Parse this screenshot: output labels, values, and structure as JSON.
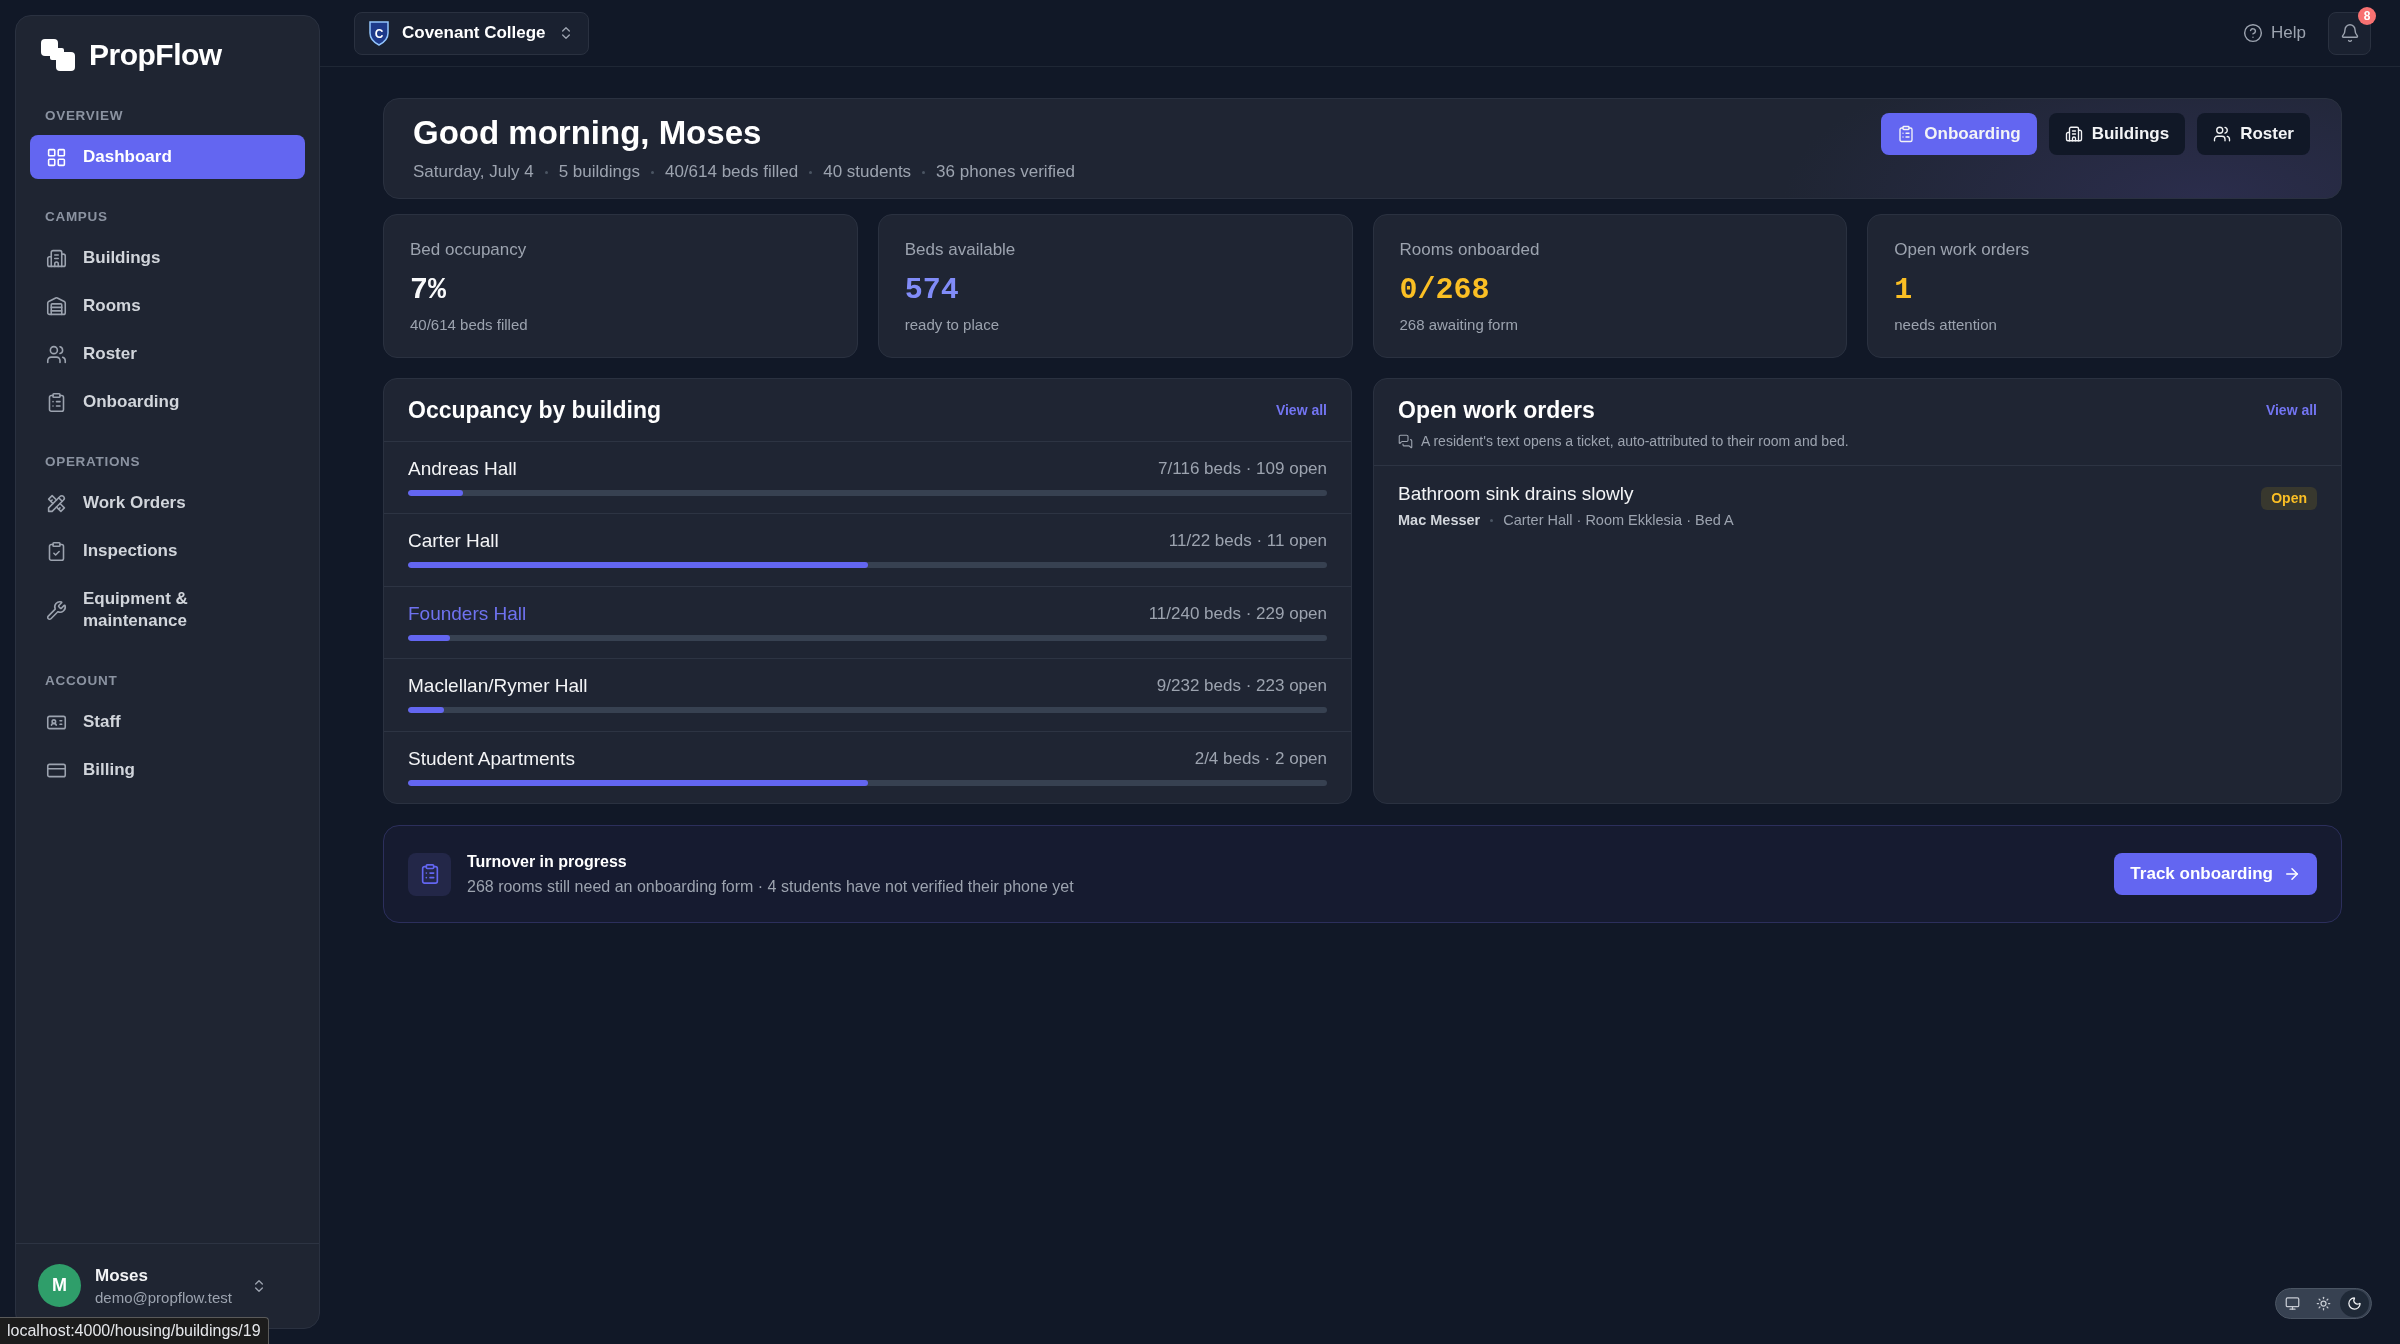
{
  "sidebar": {
    "brand": "PropFlow",
    "sections": [
      {
        "heading": "OVERVIEW",
        "items": [
          {
            "label": "Dashboard",
            "selected": true
          }
        ]
      },
      {
        "heading": "CAMPUS",
        "items": [
          {
            "label": "Buildings",
            "selected": false
          },
          {
            "label": "Rooms",
            "selected": false
          },
          {
            "label": "Roster",
            "selected": false
          },
          {
            "label": "Onboarding",
            "selected": false
          }
        ]
      },
      {
        "heading": "OPERATIONS",
        "items": [
          {
            "label": "Work Orders",
            "selected": false
          },
          {
            "label": "Inspections",
            "selected": false
          },
          {
            "label": "Equipment & maintenance",
            "selected": false
          }
        ]
      },
      {
        "heading": "ACCOUNT",
        "items": [
          {
            "label": "Staff",
            "selected": false
          },
          {
            "label": "Billing",
            "selected": false
          }
        ]
      }
    ],
    "user": {
      "initial": "M",
      "name": "Moses",
      "email": "demo@propflow.test"
    }
  },
  "top_bar": {
    "campus": {
      "crest_letter": "C",
      "name": "Covenant College"
    },
    "help": "Help",
    "notifications": {
      "count": "8"
    }
  },
  "header": {
    "greeting": "Good morning, Moses",
    "facts": [
      "Saturday, July 4",
      "5 buildings",
      "40/614 beds filled",
      "40 students",
      "36 phones verified"
    ],
    "actions": [
      {
        "label": "Onboarding",
        "primary": true
      },
      {
        "label": "Buildings",
        "primary": false
      },
      {
        "label": "Roster",
        "primary": false
      }
    ]
  },
  "stats": [
    {
      "label": "Bed occupancy",
      "value": "7%",
      "note": "40/614 beds filled",
      "color": "#f9fafb"
    },
    {
      "label": "Beds available",
      "value": "574",
      "note": "ready to place",
      "color": "#818cf8"
    },
    {
      "label": "Rooms onboarded",
      "value": "0/268",
      "note": "268 awaiting form",
      "color": "#fbbf24"
    },
    {
      "label": "Open work orders",
      "value": "1",
      "note": "needs attention",
      "color": "#fbbf24"
    }
  ],
  "occupancy": {
    "title": "Occupancy by building",
    "link": "View all",
    "buildings": [
      {
        "name": "Andreas Hall",
        "summary": "7/116 beds · 109 open",
        "level": 0.06,
        "highlighted": false
      },
      {
        "name": "Carter Hall",
        "summary": "11/22 beds · 11 open",
        "level": 0.5,
        "highlighted": false
      },
      {
        "name": "Founders Hall",
        "summary": "11/240 beds · 229 open",
        "level": 0.046,
        "highlighted": true
      },
      {
        "name": "Maclellan/Rymer Hall",
        "summary": "9/232 beds · 223 open",
        "level": 0.039,
        "highlighted": false
      },
      {
        "name": "Student Apartments",
        "summary": "2/4 beds · 2 open",
        "level": 0.5,
        "highlighted": false
      }
    ]
  },
  "work_orders": {
    "title": "Open work orders",
    "link": "View all",
    "hint": "A resident's text opens a ticket, auto-attributed to their room and bed.",
    "items": [
      {
        "title": "Bathroom sink drains slowly",
        "reporter": "Mac Messer",
        "location": "Carter Hall · Room Ekklesia · Bed A",
        "status": "Open"
      }
    ]
  },
  "turnover": {
    "title": "Turnover in progress",
    "message": "268 rooms still need an onboarding form · 4 students have not verified their phone yet",
    "action": "Track onboarding"
  },
  "theme_switcher": [
    {
      "kind": "system",
      "selected": false
    },
    {
      "kind": "light",
      "selected": false
    },
    {
      "kind": "dark",
      "selected": true
    }
  ],
  "status_url": "localhost:4000/housing/buildings/19"
}
